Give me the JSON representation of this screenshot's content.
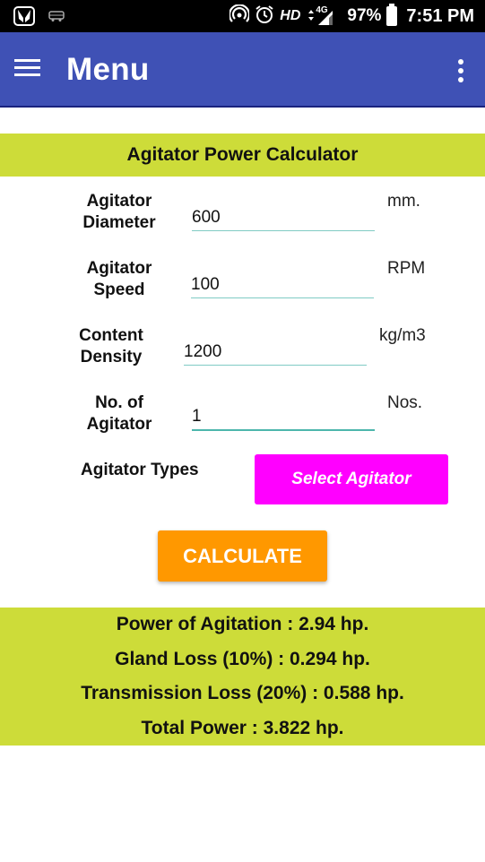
{
  "status_bar": {
    "left_icons": [
      "jiosaavn-icon",
      "bus-icon"
    ],
    "right_icons": [
      "hotspot-icon",
      "alarm-icon",
      "hd-icon",
      "data-arrows-icon",
      "signal-4g-icon",
      "battery-icon"
    ],
    "hd_label": "HD",
    "network_label": "4G",
    "battery": "97%",
    "time": "7:51 PM"
  },
  "app_bar": {
    "title": "Menu",
    "menu_icon": "hamburger-icon",
    "overflow_icon": "more-vert-icon",
    "color": "#3f51b5"
  },
  "calculator": {
    "title": "Agitator Power Calculator",
    "accent_color": "#cddc39",
    "fields": [
      {
        "label_line1": "Agitator",
        "label_line2": "Diameter",
        "value": "600",
        "unit": "mm."
      },
      {
        "label_line1": "Agitator",
        "label_line2": "Speed",
        "value": "100",
        "unit": "RPM"
      },
      {
        "label_line1": "Content",
        "label_line2": "Density",
        "value": "1200",
        "unit": "kg/m3"
      },
      {
        "label_line1": "No. of",
        "label_line2": "Agitator",
        "value": "1",
        "unit": "Nos."
      }
    ],
    "types_label": "Agitator Types",
    "select_button": "Select Agitator",
    "select_color": "#ff00ff",
    "calculate_button": "CALCULATE",
    "calculate_color": "#ff9800"
  },
  "results": {
    "lines": [
      "Power of Agitation : 2.94 hp.",
      "Gland Loss (10%) : 0.294 hp.",
      "Transmission Loss (20%) : 0.588 hp.",
      "Total Power : 3.822 hp."
    ]
  }
}
